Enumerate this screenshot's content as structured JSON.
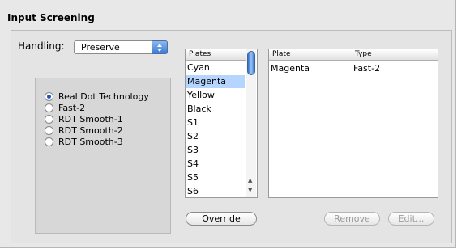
{
  "window": {
    "title": "Input Screening"
  },
  "handling": {
    "label": "Handling:",
    "value": "Preserve"
  },
  "radio_options": [
    {
      "label": "Real Dot Technology",
      "selected": true
    },
    {
      "label": "Fast-2",
      "selected": false
    },
    {
      "label": "RDT Smooth-1",
      "selected": false
    },
    {
      "label": "RDT Smooth-2",
      "selected": false
    },
    {
      "label": "RDT Smooth-3",
      "selected": false
    }
  ],
  "plates": {
    "header": "Plates",
    "items": [
      "Cyan",
      "Magenta",
      "Yellow",
      "Black",
      "S1",
      "S2",
      "S3",
      "S4",
      "S5",
      "S6"
    ],
    "selected": "Magenta"
  },
  "table": {
    "headers": {
      "plate": "Plate",
      "type": "Type"
    },
    "rows": [
      {
        "plate": "Magenta",
        "type": "Fast-2"
      }
    ]
  },
  "buttons": {
    "override": "Override",
    "remove": "Remove",
    "edit": "Edit..."
  },
  "colors": {
    "accent": "#3a7bd5",
    "selection": "#b5d5ff"
  }
}
